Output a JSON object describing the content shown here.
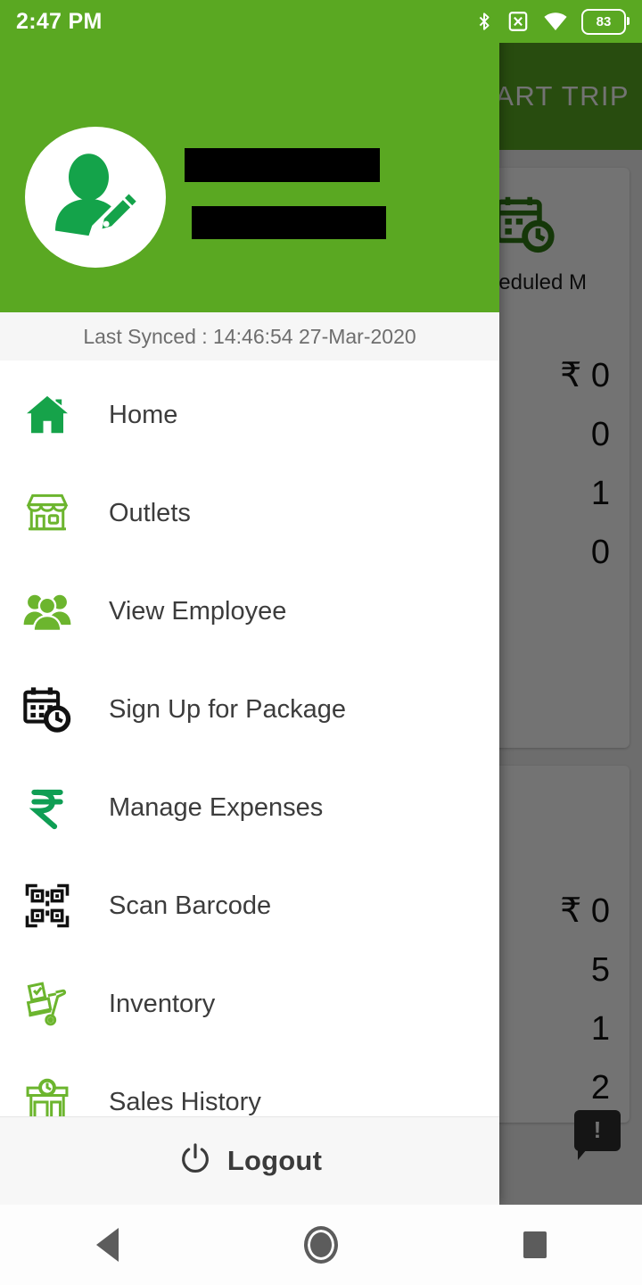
{
  "status_bar": {
    "time": "2:47 PM",
    "icons": [
      "bluetooth-icon",
      "sim-disabled-icon",
      "wifi-icon",
      "battery-icon"
    ],
    "battery_level": "83"
  },
  "colors": {
    "brand_green": "#5aa822",
    "icon_green_solid": "#1aa84f",
    "icon_green_light": "#6cb52e",
    "icon_dark": "#1a1a1a",
    "drawer_bg": "#ffffff",
    "sync_bar_bg": "#f6f6f6",
    "footer_bg": "#f7f7f7"
  },
  "drawer": {
    "avatar_icon": "user-edit-avatar-icon",
    "profile_name": "",
    "profile_subtitle": "",
    "sync_text": "Last Synced : 14:46:54 27-Mar-2020",
    "items": [
      {
        "label": "Home",
        "icon": "home-icon"
      },
      {
        "label": "Outlets",
        "icon": "storefront-icon"
      },
      {
        "label": "View Employee",
        "icon": "people-group-icon"
      },
      {
        "label": "Sign Up for Package",
        "icon": "calendar-clock-icon"
      },
      {
        "label": "Manage Expenses",
        "icon": "rupee-icon"
      },
      {
        "label": "Scan Barcode",
        "icon": "qr-code-icon"
      },
      {
        "label": "Inventory",
        "icon": "hand-truck-icon"
      },
      {
        "label": "Sales History",
        "icon": "shop-clock-icon"
      }
    ],
    "footer": {
      "logout_label": "Logout",
      "logout_icon": "power-icon"
    }
  },
  "background_app": {
    "appbar_title": "START TRIP",
    "tile": {
      "label": "Scheduled M",
      "icon": "calendar-clock-icon"
    },
    "card_one_values": [
      "₹ 0",
      "0",
      "1",
      "0"
    ],
    "card_two_values": [
      "₹ 0",
      "5",
      "1",
      "2"
    ],
    "fab": {
      "icon": "feedback-bubble-icon",
      "glyph": "!"
    }
  },
  "nav_bar": {
    "buttons": [
      {
        "name": "back",
        "icon": "triangle-back-icon"
      },
      {
        "name": "home",
        "icon": "circle-home-icon"
      },
      {
        "name": "recents",
        "icon": "square-recents-icon"
      }
    ]
  }
}
